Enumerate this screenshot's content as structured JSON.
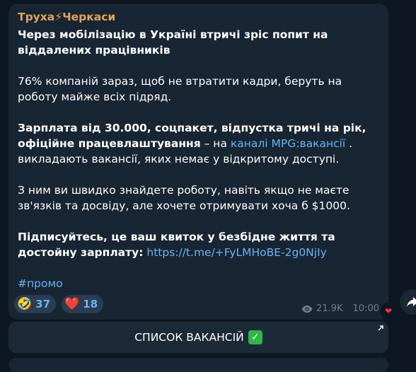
{
  "channel": {
    "name": "Труха⚡Черкаси",
    "name_color": "#e3a35a"
  },
  "message": {
    "line1_bold": "Через мобілізацію в Україні втричі зріс попит на віддалених працівників",
    "para2": "76% компаній зараз, щоб не втратити кадри, беруть на роботу майже всіх підряд.",
    "para3_bold": "Зарплата від 30.000, соцпакет, відпустка тричі на рік, офіційне працевлаштування",
    "para3_dash": " – на ",
    "para3_link": "каналі MPG:вакансії",
    "para3_rest": " . викладають вакансії, яких немає у відкритому доступі.",
    "para4": "З ним ви швидко знайдете роботу, навіть якщо не маєте зв'язків та досвіду, але хочете отримувати хоча б $1000.",
    "para5_bold": "Підписуйтесь, це ваш квиток у безбідне життя та достойну зарплату:",
    "para5_link": "https://t.me/+FyLMHoBE-2g0NjIy",
    "hashtag": "#промо"
  },
  "reactions": [
    {
      "emoji": "🤣",
      "count": "37"
    },
    {
      "emoji": "❤️",
      "count": "18"
    }
  ],
  "meta": {
    "views": "21.9K",
    "time": "10:00",
    "eye_icon": "eye-icon"
  },
  "inline_button": {
    "label": "СПИСОК ВАКАНСІЙ",
    "check": "✓"
  },
  "colors": {
    "background": "#0e1621",
    "bubble": "#182533",
    "link": "#6ab3f3",
    "meta": "#6d7f8f"
  }
}
